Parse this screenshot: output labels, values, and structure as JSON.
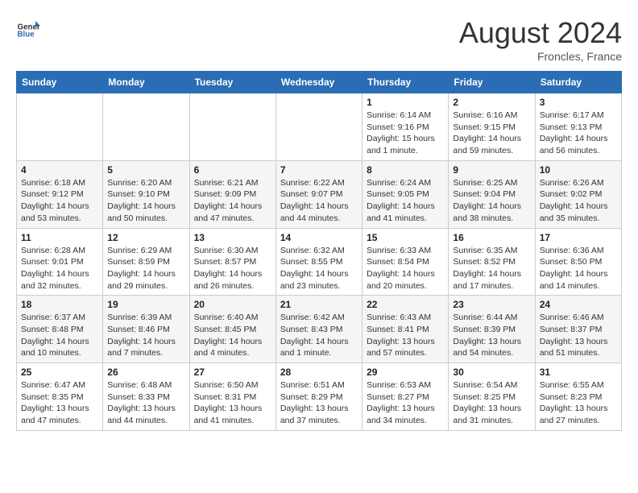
{
  "logo": {
    "text_general": "General",
    "text_blue": "Blue"
  },
  "title": {
    "month_year": "August 2024",
    "location": "Froncles, France"
  },
  "weekdays": [
    "Sunday",
    "Monday",
    "Tuesday",
    "Wednesday",
    "Thursday",
    "Friday",
    "Saturday"
  ],
  "weeks": [
    [
      {
        "day": "",
        "info": ""
      },
      {
        "day": "",
        "info": ""
      },
      {
        "day": "",
        "info": ""
      },
      {
        "day": "",
        "info": ""
      },
      {
        "day": "1",
        "info": "Sunrise: 6:14 AM\nSunset: 9:16 PM\nDaylight: 15 hours\nand 1 minute."
      },
      {
        "day": "2",
        "info": "Sunrise: 6:16 AM\nSunset: 9:15 PM\nDaylight: 14 hours\nand 59 minutes."
      },
      {
        "day": "3",
        "info": "Sunrise: 6:17 AM\nSunset: 9:13 PM\nDaylight: 14 hours\nand 56 minutes."
      }
    ],
    [
      {
        "day": "4",
        "info": "Sunrise: 6:18 AM\nSunset: 9:12 PM\nDaylight: 14 hours\nand 53 minutes."
      },
      {
        "day": "5",
        "info": "Sunrise: 6:20 AM\nSunset: 9:10 PM\nDaylight: 14 hours\nand 50 minutes."
      },
      {
        "day": "6",
        "info": "Sunrise: 6:21 AM\nSunset: 9:09 PM\nDaylight: 14 hours\nand 47 minutes."
      },
      {
        "day": "7",
        "info": "Sunrise: 6:22 AM\nSunset: 9:07 PM\nDaylight: 14 hours\nand 44 minutes."
      },
      {
        "day": "8",
        "info": "Sunrise: 6:24 AM\nSunset: 9:05 PM\nDaylight: 14 hours\nand 41 minutes."
      },
      {
        "day": "9",
        "info": "Sunrise: 6:25 AM\nSunset: 9:04 PM\nDaylight: 14 hours\nand 38 minutes."
      },
      {
        "day": "10",
        "info": "Sunrise: 6:26 AM\nSunset: 9:02 PM\nDaylight: 14 hours\nand 35 minutes."
      }
    ],
    [
      {
        "day": "11",
        "info": "Sunrise: 6:28 AM\nSunset: 9:01 PM\nDaylight: 14 hours\nand 32 minutes."
      },
      {
        "day": "12",
        "info": "Sunrise: 6:29 AM\nSunset: 8:59 PM\nDaylight: 14 hours\nand 29 minutes."
      },
      {
        "day": "13",
        "info": "Sunrise: 6:30 AM\nSunset: 8:57 PM\nDaylight: 14 hours\nand 26 minutes."
      },
      {
        "day": "14",
        "info": "Sunrise: 6:32 AM\nSunset: 8:55 PM\nDaylight: 14 hours\nand 23 minutes."
      },
      {
        "day": "15",
        "info": "Sunrise: 6:33 AM\nSunset: 8:54 PM\nDaylight: 14 hours\nand 20 minutes."
      },
      {
        "day": "16",
        "info": "Sunrise: 6:35 AM\nSunset: 8:52 PM\nDaylight: 14 hours\nand 17 minutes."
      },
      {
        "day": "17",
        "info": "Sunrise: 6:36 AM\nSunset: 8:50 PM\nDaylight: 14 hours\nand 14 minutes."
      }
    ],
    [
      {
        "day": "18",
        "info": "Sunrise: 6:37 AM\nSunset: 8:48 PM\nDaylight: 14 hours\nand 10 minutes."
      },
      {
        "day": "19",
        "info": "Sunrise: 6:39 AM\nSunset: 8:46 PM\nDaylight: 14 hours\nand 7 minutes."
      },
      {
        "day": "20",
        "info": "Sunrise: 6:40 AM\nSunset: 8:45 PM\nDaylight: 14 hours\nand 4 minutes."
      },
      {
        "day": "21",
        "info": "Sunrise: 6:42 AM\nSunset: 8:43 PM\nDaylight: 14 hours\nand 1 minute."
      },
      {
        "day": "22",
        "info": "Sunrise: 6:43 AM\nSunset: 8:41 PM\nDaylight: 13 hours\nand 57 minutes."
      },
      {
        "day": "23",
        "info": "Sunrise: 6:44 AM\nSunset: 8:39 PM\nDaylight: 13 hours\nand 54 minutes."
      },
      {
        "day": "24",
        "info": "Sunrise: 6:46 AM\nSunset: 8:37 PM\nDaylight: 13 hours\nand 51 minutes."
      }
    ],
    [
      {
        "day": "25",
        "info": "Sunrise: 6:47 AM\nSunset: 8:35 PM\nDaylight: 13 hours\nand 47 minutes."
      },
      {
        "day": "26",
        "info": "Sunrise: 6:48 AM\nSunset: 8:33 PM\nDaylight: 13 hours\nand 44 minutes."
      },
      {
        "day": "27",
        "info": "Sunrise: 6:50 AM\nSunset: 8:31 PM\nDaylight: 13 hours\nand 41 minutes."
      },
      {
        "day": "28",
        "info": "Sunrise: 6:51 AM\nSunset: 8:29 PM\nDaylight: 13 hours\nand 37 minutes."
      },
      {
        "day": "29",
        "info": "Sunrise: 6:53 AM\nSunset: 8:27 PM\nDaylight: 13 hours\nand 34 minutes."
      },
      {
        "day": "30",
        "info": "Sunrise: 6:54 AM\nSunset: 8:25 PM\nDaylight: 13 hours\nand 31 minutes."
      },
      {
        "day": "31",
        "info": "Sunrise: 6:55 AM\nSunset: 8:23 PM\nDaylight: 13 hours\nand 27 minutes."
      }
    ]
  ]
}
